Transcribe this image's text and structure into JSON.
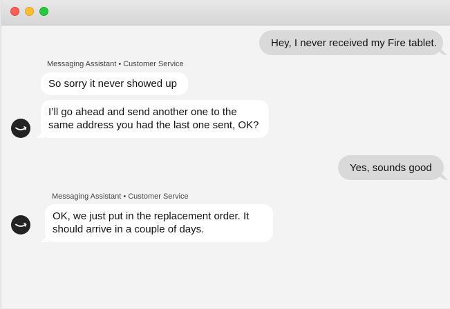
{
  "window": {
    "controls": [
      "close",
      "minimize",
      "maximize"
    ]
  },
  "messages": [
    {
      "from": "user",
      "text": "Hey, I never received my Fire tablet."
    },
    {
      "from": "bot",
      "sender": "Messaging Assistant • Customer Service",
      "text": "So sorry it never showed up"
    },
    {
      "from": "bot",
      "lines": [
        "I’ll go ahead and send another one to the",
        "same address you had the last one sent, OK?"
      ],
      "avatar_icon": "amazon-smile-logo-icon"
    },
    {
      "from": "user",
      "text": "Yes, sounds good"
    },
    {
      "from": "bot",
      "sender": "Messaging Assistant • Customer Service",
      "lines": [
        "OK, we just put in the replacement order. It",
        "should arrive in a couple of days."
      ],
      "avatar_icon": "amazon-smile-logo-icon"
    }
  ],
  "colors": {
    "user_bubble": "#d9d9d9",
    "bot_bubble": "#ffffff",
    "background": "#f3f3f3",
    "avatar": "#232323"
  }
}
